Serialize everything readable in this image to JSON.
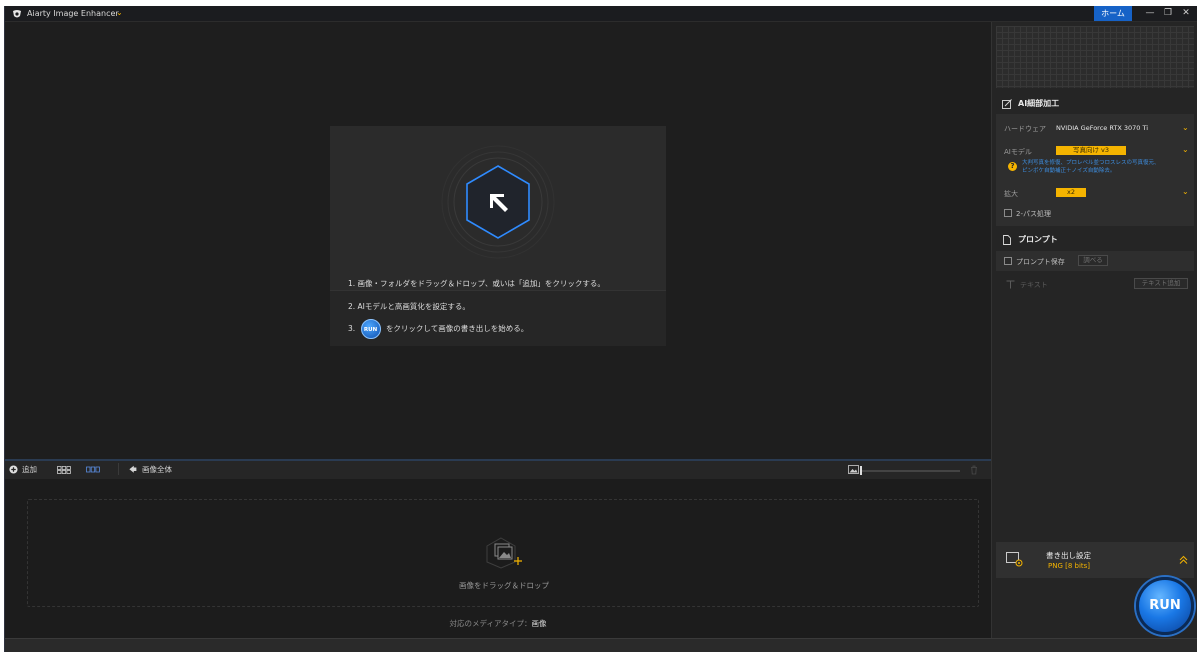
{
  "app": {
    "title": "Aiarty Image Enhancer",
    "title_caret": "⌄"
  },
  "window": {
    "home_label": "ホーム",
    "min_glyph": "—",
    "restore_glyph": "❐",
    "close_glyph": "✕"
  },
  "welcome": {
    "steps": [
      "1. 画像・フォルダをドラッグ＆ドロップ、或いは「追加」をクリックする。",
      "2. AIモデルと高画質化を設定する。",
      "3.",
      "をクリックして画像の書き出しを始める。"
    ],
    "run_mini_label": "RUN"
  },
  "toolbar": {
    "add_label": "追加",
    "whole_image_label": "画像全体"
  },
  "drop": {
    "label": "画像をドラッグ＆ドロップ",
    "media_type_label": "対応のメディアタイプ：",
    "media_type_value": "画像"
  },
  "panel": {
    "ai_section_title": "AI細部加工",
    "hardware_label": "ハードウェア",
    "hardware_value": "NVIDIA GeForce RTX 3070 Ti",
    "model_label": "AIモデル",
    "model_value": "写真向け v3",
    "model_note_line1": "大判写真を修復、プロレベル並つロスレスの写真復元、",
    "model_note_line2": "ピンボケ自動補正＋ノイズ自動除去。",
    "scale_label": "拡大",
    "scale_value": "x2",
    "two_pass_label": "2-パス処理",
    "prompt_section_title": "プロンプト",
    "prompt_save_label": "プロンプト保存",
    "browse_label": "調べる",
    "text_label": "テキスト",
    "text_add_label": "テキスト追加",
    "export_title": "書き出し設定",
    "export_format": "PNG  [8 bits]",
    "run_label": "RUN"
  },
  "colors": {
    "accent": "#f5b400",
    "blue": "#1662c7",
    "hex_stroke": "#2f8bff"
  }
}
